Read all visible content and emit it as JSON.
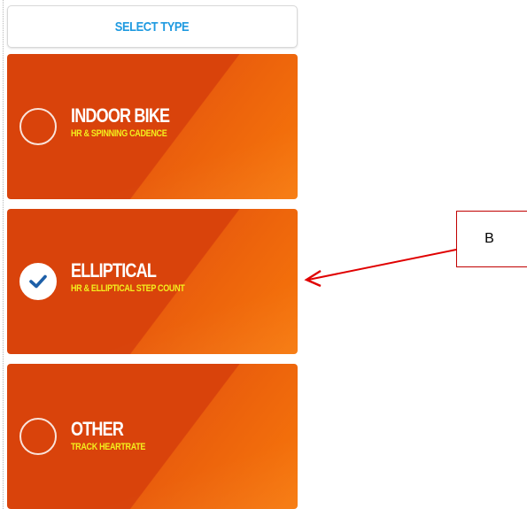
{
  "header": {
    "title": "SELECT TYPE"
  },
  "options": [
    {
      "title": "INDOOR BIKE",
      "subtitle": "HR & SPINNING CADENCE",
      "selected": false
    },
    {
      "title": "ELLIPTICAL",
      "subtitle": "HR & ELLIPTICAL STEP COUNT",
      "selected": true
    },
    {
      "title": "OTHER",
      "subtitle": "TRACK HEARTRATE",
      "selected": false
    }
  ],
  "annotation": {
    "label": "B"
  },
  "colors": {
    "header_text": "#1f9ae0",
    "card_primary": "#d9430b",
    "card_secondary": "#f7780a",
    "subtitle_text": "#f3ee1d",
    "check": "#1d5fa8",
    "callout_border": "#c00000"
  }
}
